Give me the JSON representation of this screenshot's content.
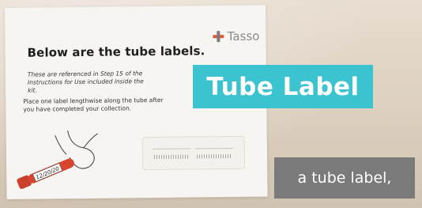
{
  "card": {
    "logo_text": "Tasso",
    "heading": "Below are the tube labels.",
    "note_lines": [
      "These are referenced in Step 15 of the",
      "Instructions for Use included inside the kit."
    ],
    "instruction_lines": [
      "Place one label lengthwise along the tube after",
      "you have completed your collection."
    ],
    "tube_label_date": "12/20/20"
  },
  "overlay": {
    "title": "Tube Label",
    "caption": "a tube label,"
  },
  "colors": {
    "title_bg": "#3cc3d0",
    "caption_bg": "#6e7073",
    "logo_accent": "#e05a3a",
    "tube_red": "#d8452e"
  }
}
